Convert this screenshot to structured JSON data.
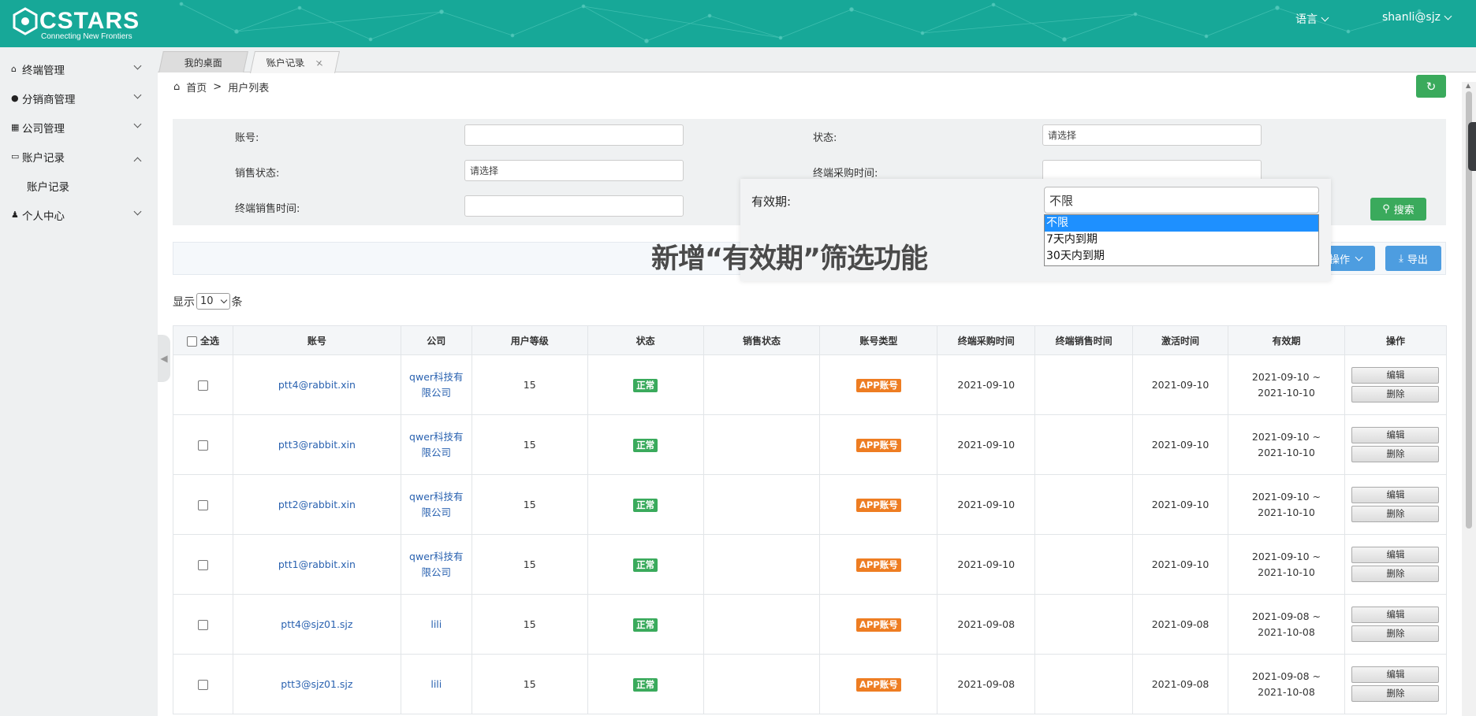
{
  "brand": {
    "name": "CSTARS",
    "tagline": "Connecting New Frontiers"
  },
  "header": {
    "language": "语言",
    "user": "shanli@sjz"
  },
  "sidebar": {
    "items": [
      {
        "label": "终端管理",
        "icon": "home-icon"
      },
      {
        "label": "分销商管理",
        "icon": "person-pin-icon"
      },
      {
        "label": "公司管理",
        "icon": "building-icon"
      },
      {
        "label": "账户记录",
        "icon": "card-icon",
        "expanded": true
      },
      {
        "label": "个人中心",
        "icon": "user-icon"
      }
    ],
    "subitem": "账户记录"
  },
  "tabs": [
    {
      "label": "我的桌面"
    },
    {
      "label": "账户记录",
      "close": "×"
    }
  ],
  "breadcrumb": {
    "home": "首页",
    "sep": ">",
    "current": "用户列表"
  },
  "filter": {
    "account_label": "账号:",
    "status_label": "状态:",
    "status_placeholder": "请选择",
    "sales_status_label": "销售状态:",
    "sales_status_placeholder": "请选择",
    "purchase_time_label": "终端采购时间:",
    "sale_time_label": "终端销售时间:",
    "search": "搜索"
  },
  "validity_popup": {
    "label": "有效期:",
    "value": "不限",
    "options": [
      "不限",
      "7天内到期",
      "30天内到期"
    ],
    "overlay_text": "新增“有效期”筛选功能"
  },
  "actions": {
    "operate": "操作",
    "export": "导出"
  },
  "pagesize": {
    "prefix": "显示",
    "value": "10",
    "suffix": "条"
  },
  "table": {
    "headers": [
      "全选",
      "账号",
      "公司",
      "用户等级",
      "状态",
      "销售状态",
      "账号类型",
      "终端采购时间",
      "终端销售时间",
      "激活时间",
      "有效期",
      "操作"
    ],
    "rows": [
      {
        "account": "ptt4@rabbit.xin",
        "company": "qwer科技有限公司",
        "level": "15",
        "status": "正常",
        "sales_status": "",
        "type": "APP账号",
        "purchase": "2021-09-10",
        "sale": "",
        "activate": "2021-09-10",
        "validity": "2021-09-10 ~ 2021-10-10"
      },
      {
        "account": "ptt3@rabbit.xin",
        "company": "qwer科技有限公司",
        "level": "15",
        "status": "正常",
        "sales_status": "",
        "type": "APP账号",
        "purchase": "2021-09-10",
        "sale": "",
        "activate": "2021-09-10",
        "validity": "2021-09-10 ~ 2021-10-10"
      },
      {
        "account": "ptt2@rabbit.xin",
        "company": "qwer科技有限公司",
        "level": "15",
        "status": "正常",
        "sales_status": "",
        "type": "APP账号",
        "purchase": "2021-09-10",
        "sale": "",
        "activate": "2021-09-10",
        "validity": "2021-09-10 ~ 2021-10-10"
      },
      {
        "account": "ptt1@rabbit.xin",
        "company": "qwer科技有限公司",
        "level": "15",
        "status": "正常",
        "sales_status": "",
        "type": "APP账号",
        "purchase": "2021-09-10",
        "sale": "",
        "activate": "2021-09-10",
        "validity": "2021-09-10 ~ 2021-10-10"
      },
      {
        "account": "ptt4@sjz01.sjz",
        "company": "lili",
        "level": "15",
        "status": "正常",
        "sales_status": "",
        "type": "APP账号",
        "purchase": "2021-09-08",
        "sale": "",
        "activate": "2021-09-08",
        "validity": "2021-09-08 ~ 2021-10-08"
      },
      {
        "account": "ptt3@sjz01.sjz",
        "company": "lili",
        "level": "15",
        "status": "正常",
        "sales_status": "",
        "type": "APP账号",
        "purchase": "2021-09-08",
        "sale": "",
        "activate": "2021-09-08",
        "validity": "2021-09-08 ~ 2021-10-08"
      }
    ],
    "edit": "编辑",
    "delete": "删除"
  },
  "colors": {
    "header": "#17a898",
    "green": "#3aaa5c",
    "blue": "#4d9de0",
    "orange": "#ee7d22",
    "link": "#2a62b0"
  }
}
